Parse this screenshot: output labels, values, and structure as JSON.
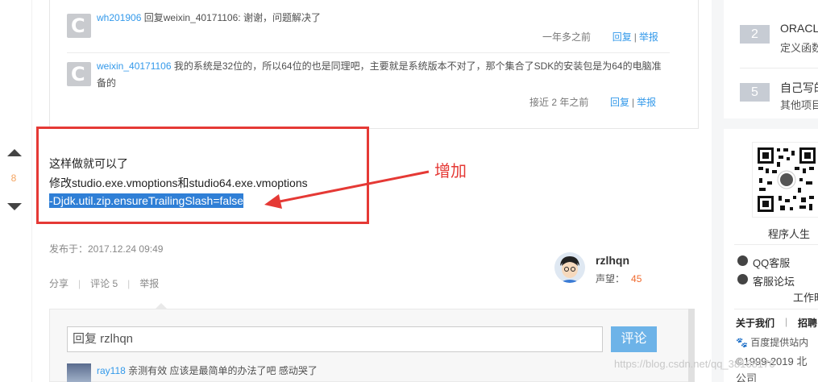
{
  "comments": [
    {
      "user": "wh201906",
      "action": "回复weixin_40171106:",
      "text": "谢谢，问题解决了",
      "time": "一年多之前",
      "reply": "回复",
      "report": "举报"
    },
    {
      "user": "weixin_40171106",
      "text_line1": "我的系统是32位的，所以64位的也是同理吧，主要就是系统版本不对了，那个集合了SDK的安装包是为64的电脑准",
      "text_line2": "备的",
      "time": "接近 2 年之前",
      "reply": "回复",
      "report": "举报"
    }
  ],
  "vote": {
    "count": "8"
  },
  "answer": {
    "line1": "这样做就可以了",
    "line2": "修改studio.exe.vmoptions和studio64.exe.vmoptions",
    "line3": "-Djdk.util.zip.ensureTrailingSlash=false"
  },
  "annotation": "增加",
  "published": "发布于：2017.12.24 09:49",
  "actions": {
    "share": "分享",
    "comments": "评论 5",
    "report": "举报"
  },
  "author": {
    "name": "rzlhqn",
    "rep_label": "声望：",
    "rep_value": "45"
  },
  "reply": {
    "input_value": "回复 rzlhqn",
    "submit": "评论"
  },
  "reply2": {
    "user": "ray118",
    "text": "亲测有效 应该是最简单的办法了吧 感动哭了"
  },
  "watermark": "https://blog.csdn.net/qq_38168176",
  "sidebar": {
    "ranks": [
      {
        "num": "2",
        "title": "ORACL",
        "sub": "定义函数"
      },
      {
        "num": "5",
        "title": "自己写的",
        "sub": "其他项目"
      }
    ],
    "qr_label": "程序人生",
    "qq": "QQ客服",
    "forum": "客服论坛",
    "work": "工作时",
    "about": "关于我们",
    "recruit": "招聘",
    "baidu": "百度提供站内",
    "copyright": "©1999-2019 北",
    "company": "公司"
  },
  "colors": {
    "link": "#3399ea",
    "highlight": "#e53935",
    "rep": "#f06a2e"
  }
}
